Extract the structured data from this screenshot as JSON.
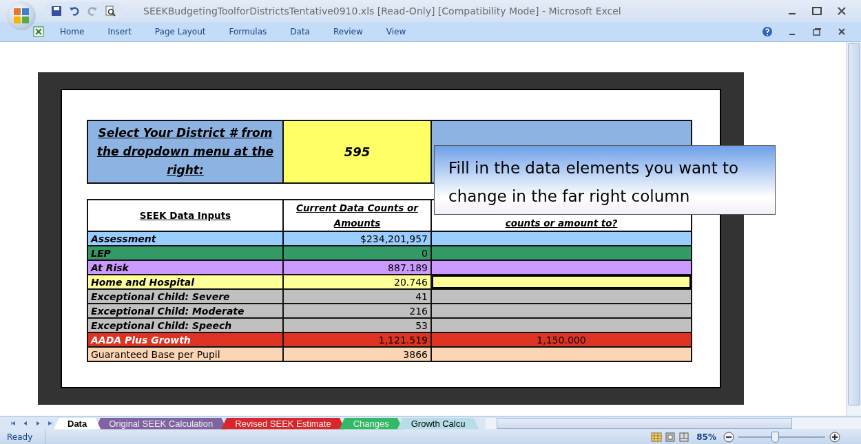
{
  "window": {
    "title": "SEEKBudgetingToolforDistrictsTentative0910.xls  [Read-Only]  [Compatibility Mode] - Microsoft Excel"
  },
  "ribbon_tabs": [
    {
      "label": "Home",
      "selected": false
    },
    {
      "label": "Insert",
      "selected": false
    },
    {
      "label": "Page Layout",
      "selected": false
    },
    {
      "label": "Formulas",
      "selected": false
    },
    {
      "label": "Data",
      "selected": false
    },
    {
      "label": "Review",
      "selected": false
    },
    {
      "label": "View",
      "selected": false
    }
  ],
  "district": {
    "prompt": "Select Your District # from the dropdown menu at the right:",
    "value": "595"
  },
  "table": {
    "columns": [
      "SEEK Data Inputs",
      "Current Data Counts or Amounts",
      "counts or amount to?"
    ],
    "rows": [
      {
        "label": "Assessment",
        "current": "$234,201,957",
        "new": "",
        "color": "#99ccff",
        "bold": true,
        "selected": false
      },
      {
        "label": "LEP",
        "current": "0",
        "new": "",
        "color": "#339966",
        "bold": true,
        "selected": false
      },
      {
        "label": "At Risk",
        "current": "887.189",
        "new": "",
        "color": "#cc99ff",
        "bold": true,
        "selected": false
      },
      {
        "label": "Home and Hospital",
        "current": "20.746",
        "new": "",
        "color": "#ffff99",
        "bold": true,
        "selected": true
      },
      {
        "label": "Exceptional Child: Severe",
        "current": "41",
        "new": "",
        "color": "#c0c0c0",
        "bold": true,
        "selected": false
      },
      {
        "label": "Exceptional Child: Moderate",
        "current": "216",
        "new": "",
        "color": "#c0c0c0",
        "bold": true,
        "selected": false
      },
      {
        "label": "Exceptional Child: Speech",
        "current": "53",
        "new": "",
        "color": "#c0c0c0",
        "bold": true,
        "selected": false
      },
      {
        "label": "AADA Plus Growth",
        "current": "1,121.519",
        "new": "1,150.000",
        "color": "#dd3322",
        "bold": true,
        "selected": false
      },
      {
        "label": "Guaranteed Base per Pupil",
        "current": "3866",
        "new": "",
        "color": "#fcd5b4",
        "bold": false,
        "selected": false
      }
    ]
  },
  "callout": {
    "text": "Fill in the data elements you want to change in the far right column"
  },
  "sheet_tabs": [
    {
      "label": "Data",
      "selected": true,
      "color": "#ffffff"
    },
    {
      "label": "Original SEEK Calculation",
      "selected": false,
      "color": "#8064a2"
    },
    {
      "label": "Revised SEEK Estimate",
      "selected": false,
      "color": "#d9262b"
    },
    {
      "label": "Changes",
      "selected": false,
      "color": "#33b865"
    },
    {
      "label": "Growth Calcu",
      "selected": false,
      "color": "#b7dee8"
    }
  ],
  "status_bar": {
    "text": "Ready",
    "zoom": "85%",
    "zoom_slider": {
      "level": 0.42
    }
  }
}
